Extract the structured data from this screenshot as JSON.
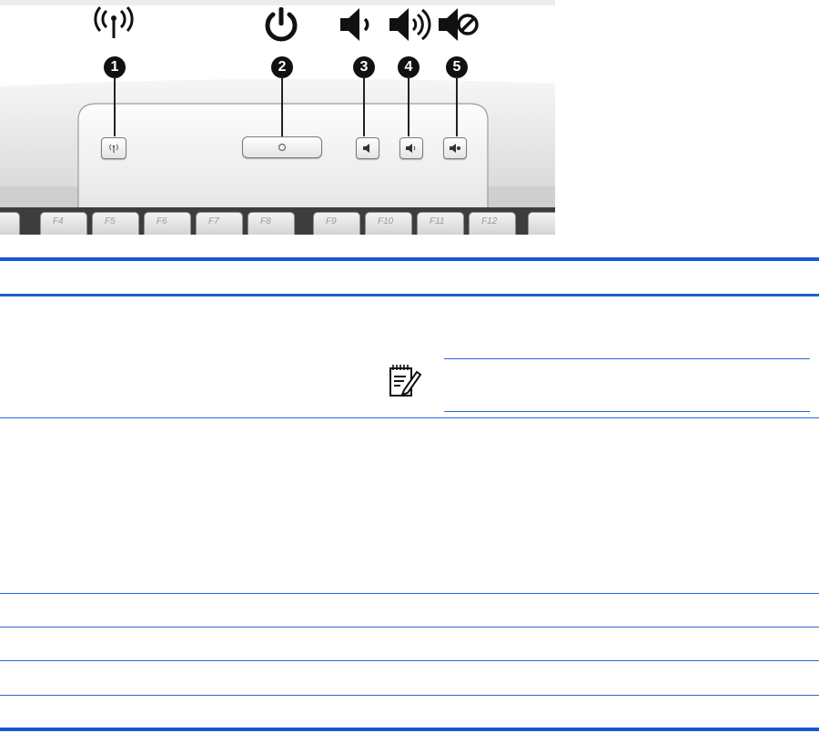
{
  "callouts": [
    "1",
    "2",
    "3",
    "4",
    "5"
  ],
  "keys": [
    "F4",
    "F5",
    "F6",
    "F7",
    "F8",
    "F9",
    "F10",
    "F11",
    "F12"
  ],
  "icons": [
    "wireless-icon",
    "power-icon",
    "volume-down-icon",
    "volume-up-icon",
    "volume-mute-icon",
    "note-icon"
  ],
  "colors": {
    "table_rule": "#1f5fd6",
    "panel": "#e2e2e2"
  },
  "table": {
    "header": {
      "component": "",
      "description": ""
    },
    "rows": [
      {
        "component": "",
        "description": "",
        "note": ""
      },
      {
        "component": "",
        "description": ""
      },
      {
        "component": "",
        "description": ""
      },
      {
        "component": "",
        "description": ""
      },
      {
        "component": "",
        "description": ""
      },
      {
        "component": "",
        "description": ""
      }
    ]
  }
}
